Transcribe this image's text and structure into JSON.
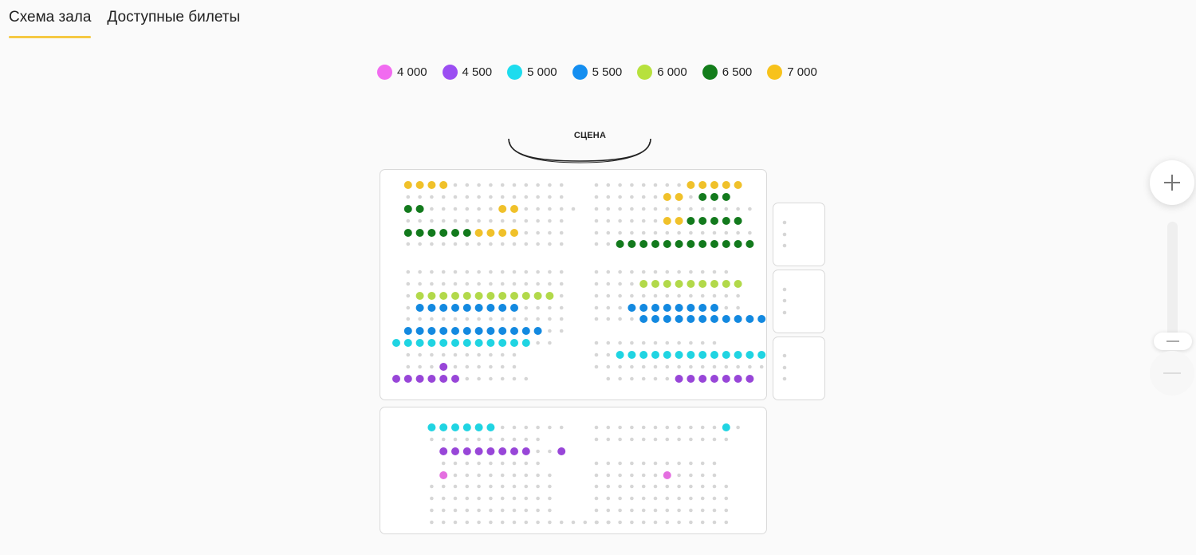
{
  "tabs": [
    {
      "label": "Схема зала",
      "active": true
    },
    {
      "label": "Доступные билеты",
      "active": false
    }
  ],
  "legend": [
    {
      "price": "4 000",
      "color": "#f16bf0"
    },
    {
      "price": "4 500",
      "color": "#9b4ef2"
    },
    {
      "price": "5 000",
      "color": "#1ddcee"
    },
    {
      "price": "5 500",
      "color": "#148ef0"
    },
    {
      "price": "6 000",
      "color": "#b7e13d"
    },
    {
      "price": "6 500",
      "color": "#137d1b"
    },
    {
      "price": "7 000",
      "color": "#f7c21b"
    }
  ],
  "stage": {
    "label": "СЦЕНА"
  },
  "seat_colors": {
    "pink": "#e46fe0",
    "purple": "#9846d8",
    "cyan": "#20d4e2",
    "blue": "#1389e0",
    "lime": "#b2d94a",
    "green": "#137a1d",
    "yellow": "#f0c12a",
    "unavailable": "#d6d6d6"
  },
  "zoom": {
    "plus_icon": "plus-icon",
    "minus_icon": "minus-icon",
    "level": 0
  }
}
